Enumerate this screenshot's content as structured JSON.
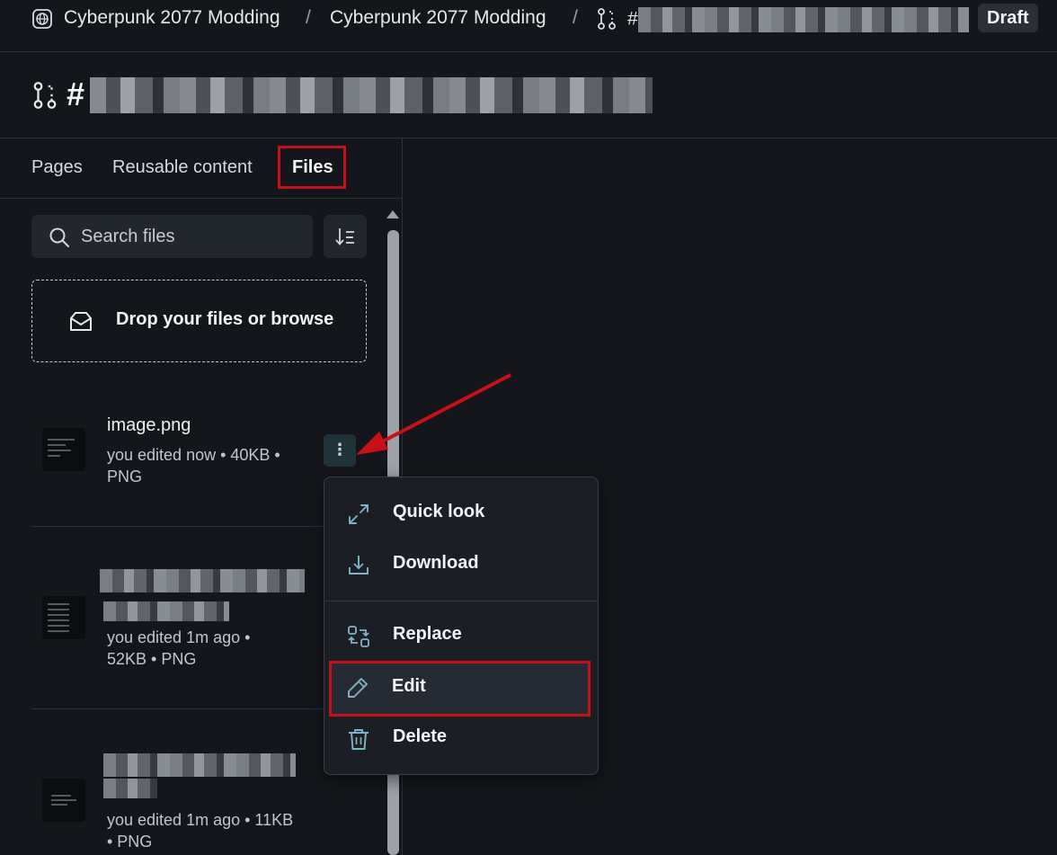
{
  "breadcrumb": {
    "space_name": "Cyberpunk 2077 Modding",
    "collection_name": "Cyberpunk 2077 Modding",
    "separator": "/",
    "change_request_prefix": "#",
    "status_badge": "Draft"
  },
  "page_title": {
    "prefix": "#"
  },
  "tabs": [
    {
      "label": "Pages"
    },
    {
      "label": "Reusable content"
    },
    {
      "label": "Files"
    }
  ],
  "search": {
    "placeholder": "Search files"
  },
  "dropzone": {
    "label": "Drop your files or browse"
  },
  "files": [
    {
      "name": "image.png",
      "meta_line1": "you edited now • 40KB •",
      "meta_line2": "PNG"
    },
    {
      "meta_line1": "you edited 1m ago •",
      "meta_line2": "52KB • PNG"
    },
    {
      "meta_line1": "you edited 1m ago • 11KB",
      "meta_line2": "• PNG"
    }
  ],
  "kebab": {
    "glyph": "⋮"
  },
  "context_menu": {
    "items": [
      {
        "label": "Quick look",
        "icon": "expand-icon"
      },
      {
        "label": "Download",
        "icon": "download-icon"
      },
      {
        "label": "Replace",
        "icon": "replace-icon"
      },
      {
        "label": "Edit",
        "icon": "pencil-icon"
      },
      {
        "label": "Delete",
        "icon": "trash-icon"
      }
    ]
  },
  "colors": {
    "background": "#14161b",
    "accent_icon": "#7fb3c7",
    "annotation_red": "#c8101a"
  }
}
